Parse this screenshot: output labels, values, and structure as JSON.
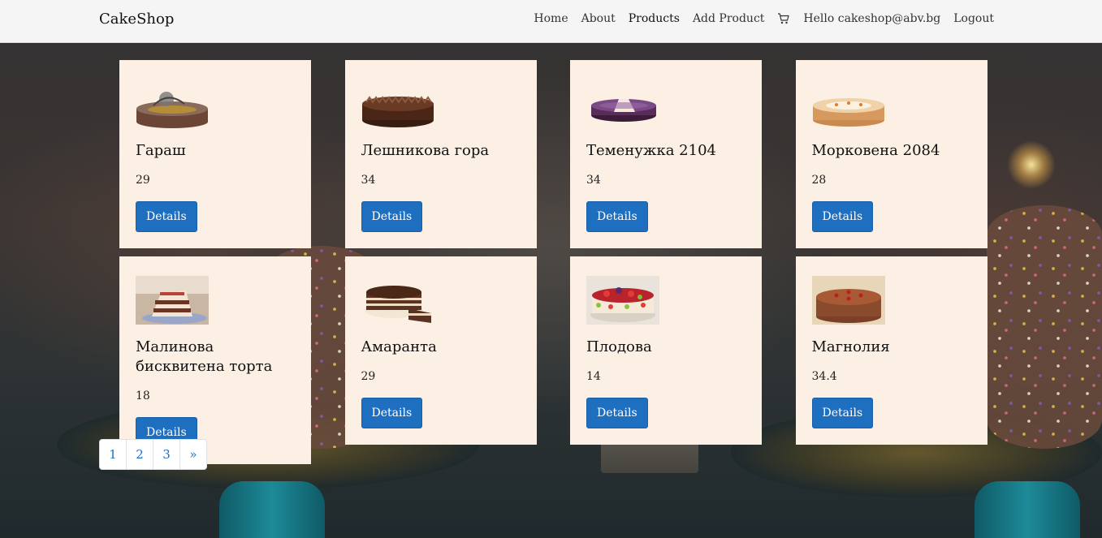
{
  "navbar": {
    "brand": "CakeShop",
    "links": [
      {
        "label": "Home"
      },
      {
        "label": "About"
      },
      {
        "label": "Products"
      },
      {
        "label": "Add Product"
      }
    ],
    "cart_icon": "cart-icon",
    "greeting": "Hello cakeshop@abv.bg",
    "logout": "Logout"
  },
  "products": [
    {
      "name": "Гараш",
      "price": "29",
      "button": "Details"
    },
    {
      "name": "Лешникова гора",
      "price": "34",
      "button": "Details"
    },
    {
      "name": "Теменужка 2104",
      "price": "34",
      "button": "Details"
    },
    {
      "name": "Морковена 2084",
      "price": "28",
      "button": "Details"
    },
    {
      "name": "Малинова бисквитена торта",
      "price": "18",
      "button": "Details"
    },
    {
      "name": "Амаранта",
      "price": "29",
      "button": "Details"
    },
    {
      "name": "Плодова",
      "price": "14",
      "button": "Details"
    },
    {
      "name": "Магнолия",
      "price": "34.4",
      "button": "Details"
    }
  ],
  "pagination": {
    "pages": [
      "1",
      "2",
      "3"
    ],
    "next": "»"
  },
  "colors": {
    "card_bg": "#fcefe4",
    "button_bg": "#1f6fc1",
    "navbar_bg": "#f5f5f5",
    "link": "#1f6fc1"
  }
}
